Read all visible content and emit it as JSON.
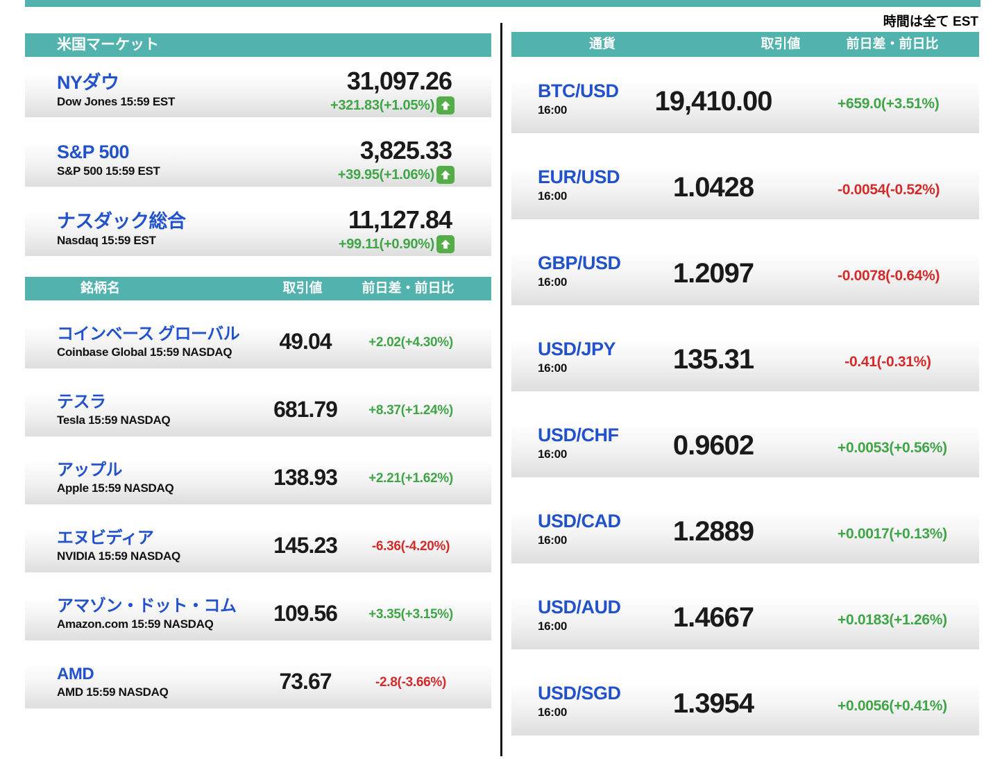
{
  "meta": {
    "est_note": "時間は全て EST"
  },
  "colors": {
    "teal": "#51b2ae",
    "link_blue": "#2152cc",
    "up_green": "#3fa546",
    "down_red": "#d32b2a",
    "arrow_badge_green": "#55ad4a"
  },
  "us_market": {
    "header": "米国マーケット",
    "indices": [
      {
        "name": "NYダウ",
        "sub": "Dow Jones 15:59 EST",
        "value": "31,097.26",
        "change": "+321.83(+1.05%)",
        "dir": "up"
      },
      {
        "name": "S&P 500",
        "sub": "S&P 500 15:59 EST",
        "value": "3,825.33",
        "change": "+39.95(+1.06%)",
        "dir": "up"
      },
      {
        "name": "ナスダック総合",
        "sub": "Nasdaq 15:59 EST",
        "value": "11,127.84",
        "change": "+99.11(+0.90%)",
        "dir": "up"
      }
    ],
    "table_header": {
      "name": "銘柄名",
      "price": "取引値",
      "change": "前日差・前日比"
    },
    "stocks": [
      {
        "name": "コインベース グローバル",
        "sub": "Coinbase Global 15:59  NASDAQ",
        "value": "49.04",
        "change": "+2.02(+4.30%)",
        "dir": "up"
      },
      {
        "name": "テスラ",
        "sub": "Tesla 15:59  NASDAQ",
        "value": "681.79",
        "change": "+8.37(+1.24%)",
        "dir": "up"
      },
      {
        "name": "アップル",
        "sub": "Apple 15:59  NASDAQ",
        "value": "138.93",
        "change": "+2.21(+1.62%)",
        "dir": "up"
      },
      {
        "name": "エヌビディア",
        "sub": "NVIDIA 15:59  NASDAQ",
        "value": "145.23",
        "change": "-6.36(-4.20%)",
        "dir": "down"
      },
      {
        "name": "アマゾン・ドット・コム",
        "sub": "Amazon.com 15:59  NASDAQ",
        "value": "109.56",
        "change": "+3.35(+3.15%)",
        "dir": "up"
      },
      {
        "name": "AMD",
        "sub": "AMD 15:59  NASDAQ",
        "value": "73.67",
        "change": "-2.8(-3.66%)",
        "dir": "down"
      }
    ]
  },
  "currencies": {
    "header": {
      "name": "通貨",
      "price": "取引値",
      "change": "前日差・前日比"
    },
    "pairs": [
      {
        "name": "BTC/USD",
        "time": "16:00",
        "value": "19,410.00",
        "change": "+659.0(+3.51%)",
        "dir": "up"
      },
      {
        "name": "EUR/USD",
        "time": "16:00",
        "value": "1.0428",
        "change": "-0.0054(-0.52%)",
        "dir": "down"
      },
      {
        "name": "GBP/USD",
        "time": "16:00",
        "value": "1.2097",
        "change": "-0.0078(-0.64%)",
        "dir": "down"
      },
      {
        "name": "USD/JPY",
        "time": "16:00",
        "value": "135.31",
        "change": "-0.41(-0.31%)",
        "dir": "down"
      },
      {
        "name": "USD/CHF",
        "time": "16:00",
        "value": "0.9602",
        "change": "+0.0053(+0.56%)",
        "dir": "up"
      },
      {
        "name": "USD/CAD",
        "time": "16:00",
        "value": "1.2889",
        "change": "+0.0017(+0.13%)",
        "dir": "up"
      },
      {
        "name": "USD/AUD",
        "time": "16:00",
        "value": "1.4667",
        "change": "+0.0183(+1.26%)",
        "dir": "up"
      },
      {
        "name": "USD/SGD",
        "time": "16:00",
        "value": "1.3954",
        "change": "+0.0056(+0.41%)",
        "dir": "up"
      }
    ]
  }
}
